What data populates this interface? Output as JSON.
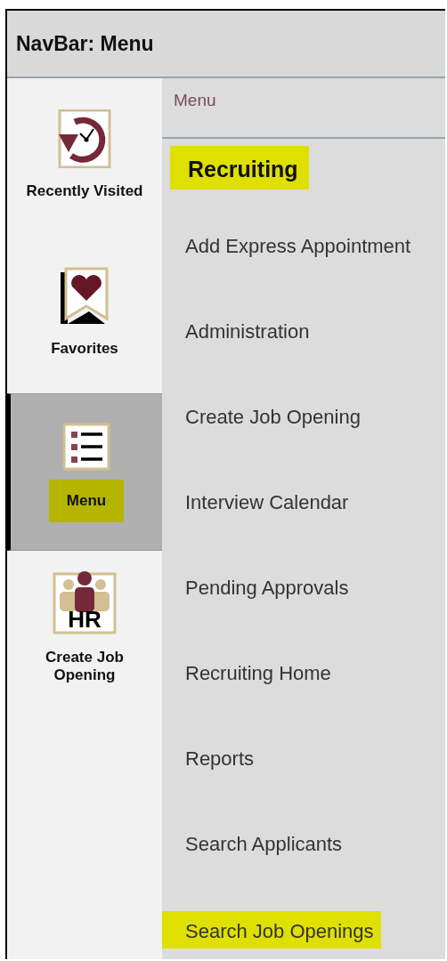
{
  "window": {
    "title": "NavBar: Menu"
  },
  "sidebar": {
    "items": [
      {
        "label": "Recently Visited",
        "kind": "clock",
        "selected": false,
        "highlighted": false
      },
      {
        "label": "Favorites",
        "kind": "heart",
        "selected": false,
        "highlighted": false
      },
      {
        "label": "Menu",
        "kind": "list",
        "selected": true,
        "highlighted": true
      },
      {
        "label": "Create Job Opening",
        "kind": "hr",
        "icon_text": "HR",
        "selected": false,
        "highlighted": false
      }
    ]
  },
  "menu": {
    "breadcrumb": "Menu",
    "heading": {
      "label": "Recruiting",
      "highlighted": true
    },
    "items": [
      {
        "label": "Add Express Appointment",
        "highlighted": false
      },
      {
        "label": "Administration",
        "highlighted": false
      },
      {
        "label": "Create Job Opening",
        "highlighted": false
      },
      {
        "label": "Interview Calendar",
        "highlighted": false
      },
      {
        "label": "Pending Approvals",
        "highlighted": false
      },
      {
        "label": "Recruiting Home",
        "highlighted": false
      },
      {
        "label": "Reports",
        "highlighted": false
      },
      {
        "label": "Search Applicants",
        "highlighted": false
      },
      {
        "label": "Search Job Openings",
        "highlighted": true
      }
    ]
  }
}
